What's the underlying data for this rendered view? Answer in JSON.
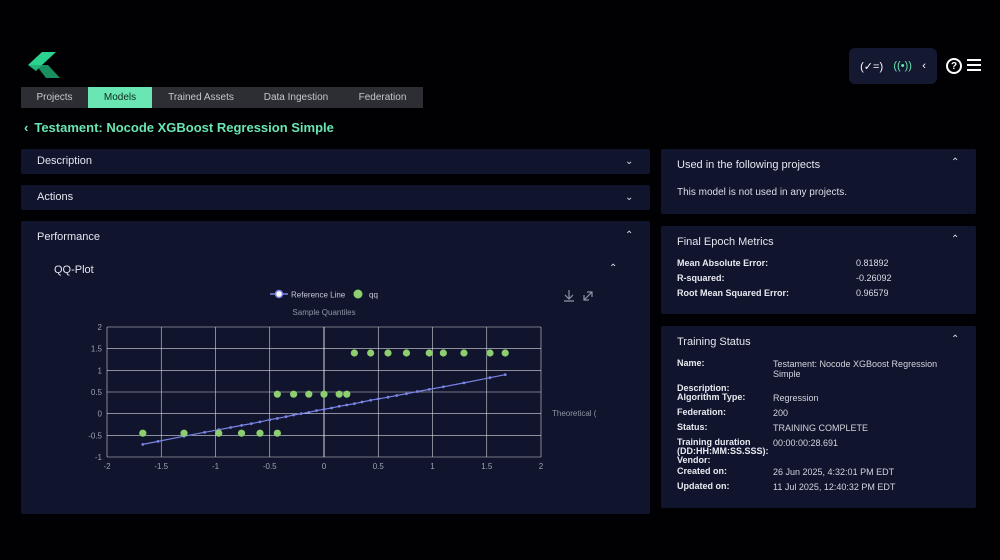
{
  "header": {
    "status_icon_left": "checklist-icon",
    "status_icon_mid": "broadcast-icon",
    "help_icon": "help-icon",
    "menu_icon": "menu-icon"
  },
  "tabs": [
    {
      "label": "Projects",
      "active": false
    },
    {
      "label": "Models",
      "active": true
    },
    {
      "label": "Trained Assets",
      "active": false
    },
    {
      "label": "Data Ingestion",
      "active": false
    },
    {
      "label": "Federation",
      "active": false
    }
  ],
  "page_title": "Testament: Nocode XGBoost Regression Simple",
  "sections": {
    "description": "Description",
    "actions": "Actions",
    "performance": "Performance",
    "qq_plot": "QQ-Plot"
  },
  "projects_panel": {
    "title": "Used in the following projects",
    "message": "This model is not used in any projects."
  },
  "metrics_panel": {
    "title": "Final Epoch Metrics",
    "rows": [
      {
        "label": "Mean Absolute Error:",
        "value": "0.81892"
      },
      {
        "label": "R-squared:",
        "value": "-0.26092"
      },
      {
        "label": "Root Mean Squared Error:",
        "value": "0.96579"
      }
    ]
  },
  "training_panel": {
    "title": "Training Status",
    "name_label": "Name:",
    "name_value_1": "Testament: Nocode XGBoost Regression",
    "name_value_2": "Simple",
    "description_label": "Description:",
    "algorithm_label": "Algorithm Type:",
    "algorithm_value": "Regression",
    "federation_label": "Federation:",
    "federation_value": "200",
    "status_label": "Status:",
    "status_value": "TRAINING COMPLETE",
    "duration_label_1": "Training duration",
    "duration_label_2": "(DD:HH:MM:SS.SSS):",
    "duration_value": "00:00:00:28.691",
    "vendor_label": "Vendor:",
    "created_label": "Created on:",
    "created_value": "26 Jun 2025, 4:32:01 PM EDT",
    "updated_label": "Updated on:",
    "updated_value": "11 Jul 2025, 12:40:32 PM EDT"
  },
  "chart_data": {
    "type": "scatter",
    "title": "Sample Quantiles",
    "xlabel": "Theoretical Quantiles",
    "xlabel_visible": "Theoretical (",
    "xlim": [
      -2,
      2
    ],
    "ylim": [
      -1,
      2
    ],
    "x_ticks": [
      "-2",
      "-1.5",
      "-1",
      "-0.5",
      "0",
      "0.5",
      "1",
      "1.5",
      "2"
    ],
    "y_ticks": [
      "-1",
      "-0.5",
      "0",
      "0.5",
      "1",
      "1.5",
      "2"
    ],
    "grid": true,
    "legend_position": "top-center",
    "series": [
      {
        "name": "Reference Line",
        "type": "line",
        "color": "#7a84e6",
        "x": [
          -1.67,
          -1.53,
          -1.29,
          -1.1,
          -0.97,
          -0.86,
          -0.76,
          -0.67,
          -0.59,
          -0.5,
          -0.43,
          -0.35,
          -0.28,
          -0.21,
          -0.14,
          -0.07,
          0.0,
          0.07,
          0.14,
          0.21,
          0.28,
          0.35,
          0.43,
          0.5,
          0.59,
          0.67,
          0.76,
          0.86,
          0.97,
          1.1,
          1.29,
          1.53,
          1.67
        ],
        "y": [
          -0.71,
          -0.64,
          -0.52,
          -0.43,
          -0.37,
          -0.32,
          -0.27,
          -0.23,
          -0.19,
          -0.14,
          -0.11,
          -0.07,
          -0.03,
          0.0,
          0.03,
          0.07,
          0.1,
          0.13,
          0.17,
          0.2,
          0.23,
          0.27,
          0.31,
          0.34,
          0.38,
          0.42,
          0.46,
          0.51,
          0.56,
          0.62,
          0.71,
          0.83,
          0.9
        ]
      },
      {
        "name": "qq",
        "type": "scatter",
        "color": "#8dcf6f",
        "x": [
          -1.67,
          -1.29,
          -0.97,
          -0.76,
          -0.59,
          -0.43,
          -0.43,
          -0.28,
          -0.14,
          0.0,
          0.14,
          0.21,
          0.28,
          0.43,
          0.59,
          0.76,
          0.97,
          1.1,
          1.29,
          1.53,
          1.67
        ],
        "y": [
          -0.45,
          -0.45,
          -0.45,
          -0.45,
          -0.45,
          -0.45,
          0.45,
          0.45,
          0.45,
          0.45,
          0.45,
          0.45,
          1.4,
          1.4,
          1.4,
          1.4,
          1.4,
          1.4,
          1.4,
          1.4,
          1.4
        ]
      }
    ]
  }
}
